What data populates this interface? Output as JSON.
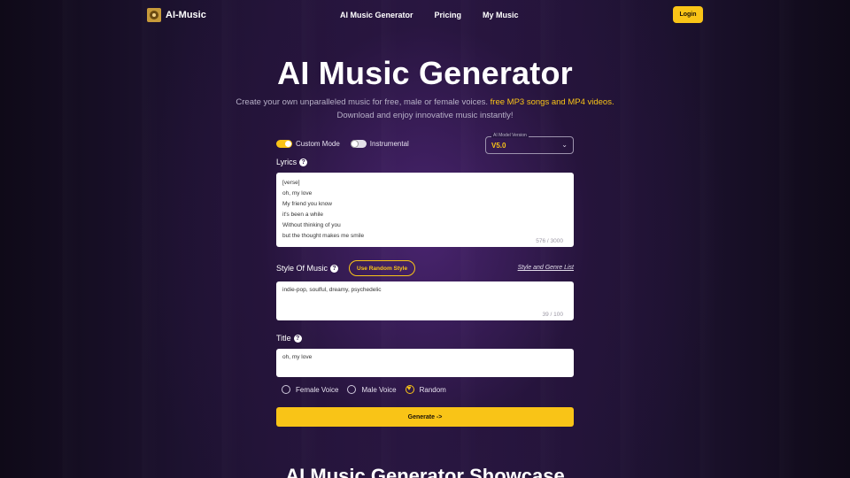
{
  "header": {
    "logo_text": "AI-Music",
    "nav": [
      "AI Music Generator",
      "Pricing",
      "My Music"
    ],
    "login_label": "Login"
  },
  "hero": {
    "title": "AI Music Generator",
    "subtitle_part1": "Create your own unparalleled music for free, male or female voices. ",
    "subtitle_highlight": "free MP3 songs and MP4 videos.",
    "subtitle_part2": "Download and enjoy innovative music instantly!"
  },
  "form": {
    "custom_mode_label": "Custom Mode",
    "custom_mode_on": true,
    "instrumental_label": "Instrumental",
    "instrumental_on": false,
    "model": {
      "legend": "AI Model Version",
      "value": "V5.0"
    },
    "lyrics": {
      "label": "Lyrics",
      "lines": [
        "[verse]",
        "oh, my love",
        "My friend you know",
        "it's been a while",
        "Without thinking of you",
        "but the thought makes me smile"
      ],
      "counter": "576 / 3000"
    },
    "style": {
      "label": "Style Of Music",
      "random_button": "Use Random Style",
      "genre_link": "Style and Genre List",
      "value": "indie-pop, soulful, dreamy, psychedelic",
      "counter": "39 / 100"
    },
    "title": {
      "label": "Title",
      "value": "oh, my love"
    },
    "voices": [
      {
        "label": "Female Voice",
        "selected": false
      },
      {
        "label": "Male Voice",
        "selected": false
      },
      {
        "label": "Random",
        "selected": true
      }
    ],
    "generate_label": "Generate ->"
  },
  "showcase_heading": "AI Music Generator Showcase",
  "colors": {
    "accent": "#f9c417",
    "background": "#2a1844"
  }
}
